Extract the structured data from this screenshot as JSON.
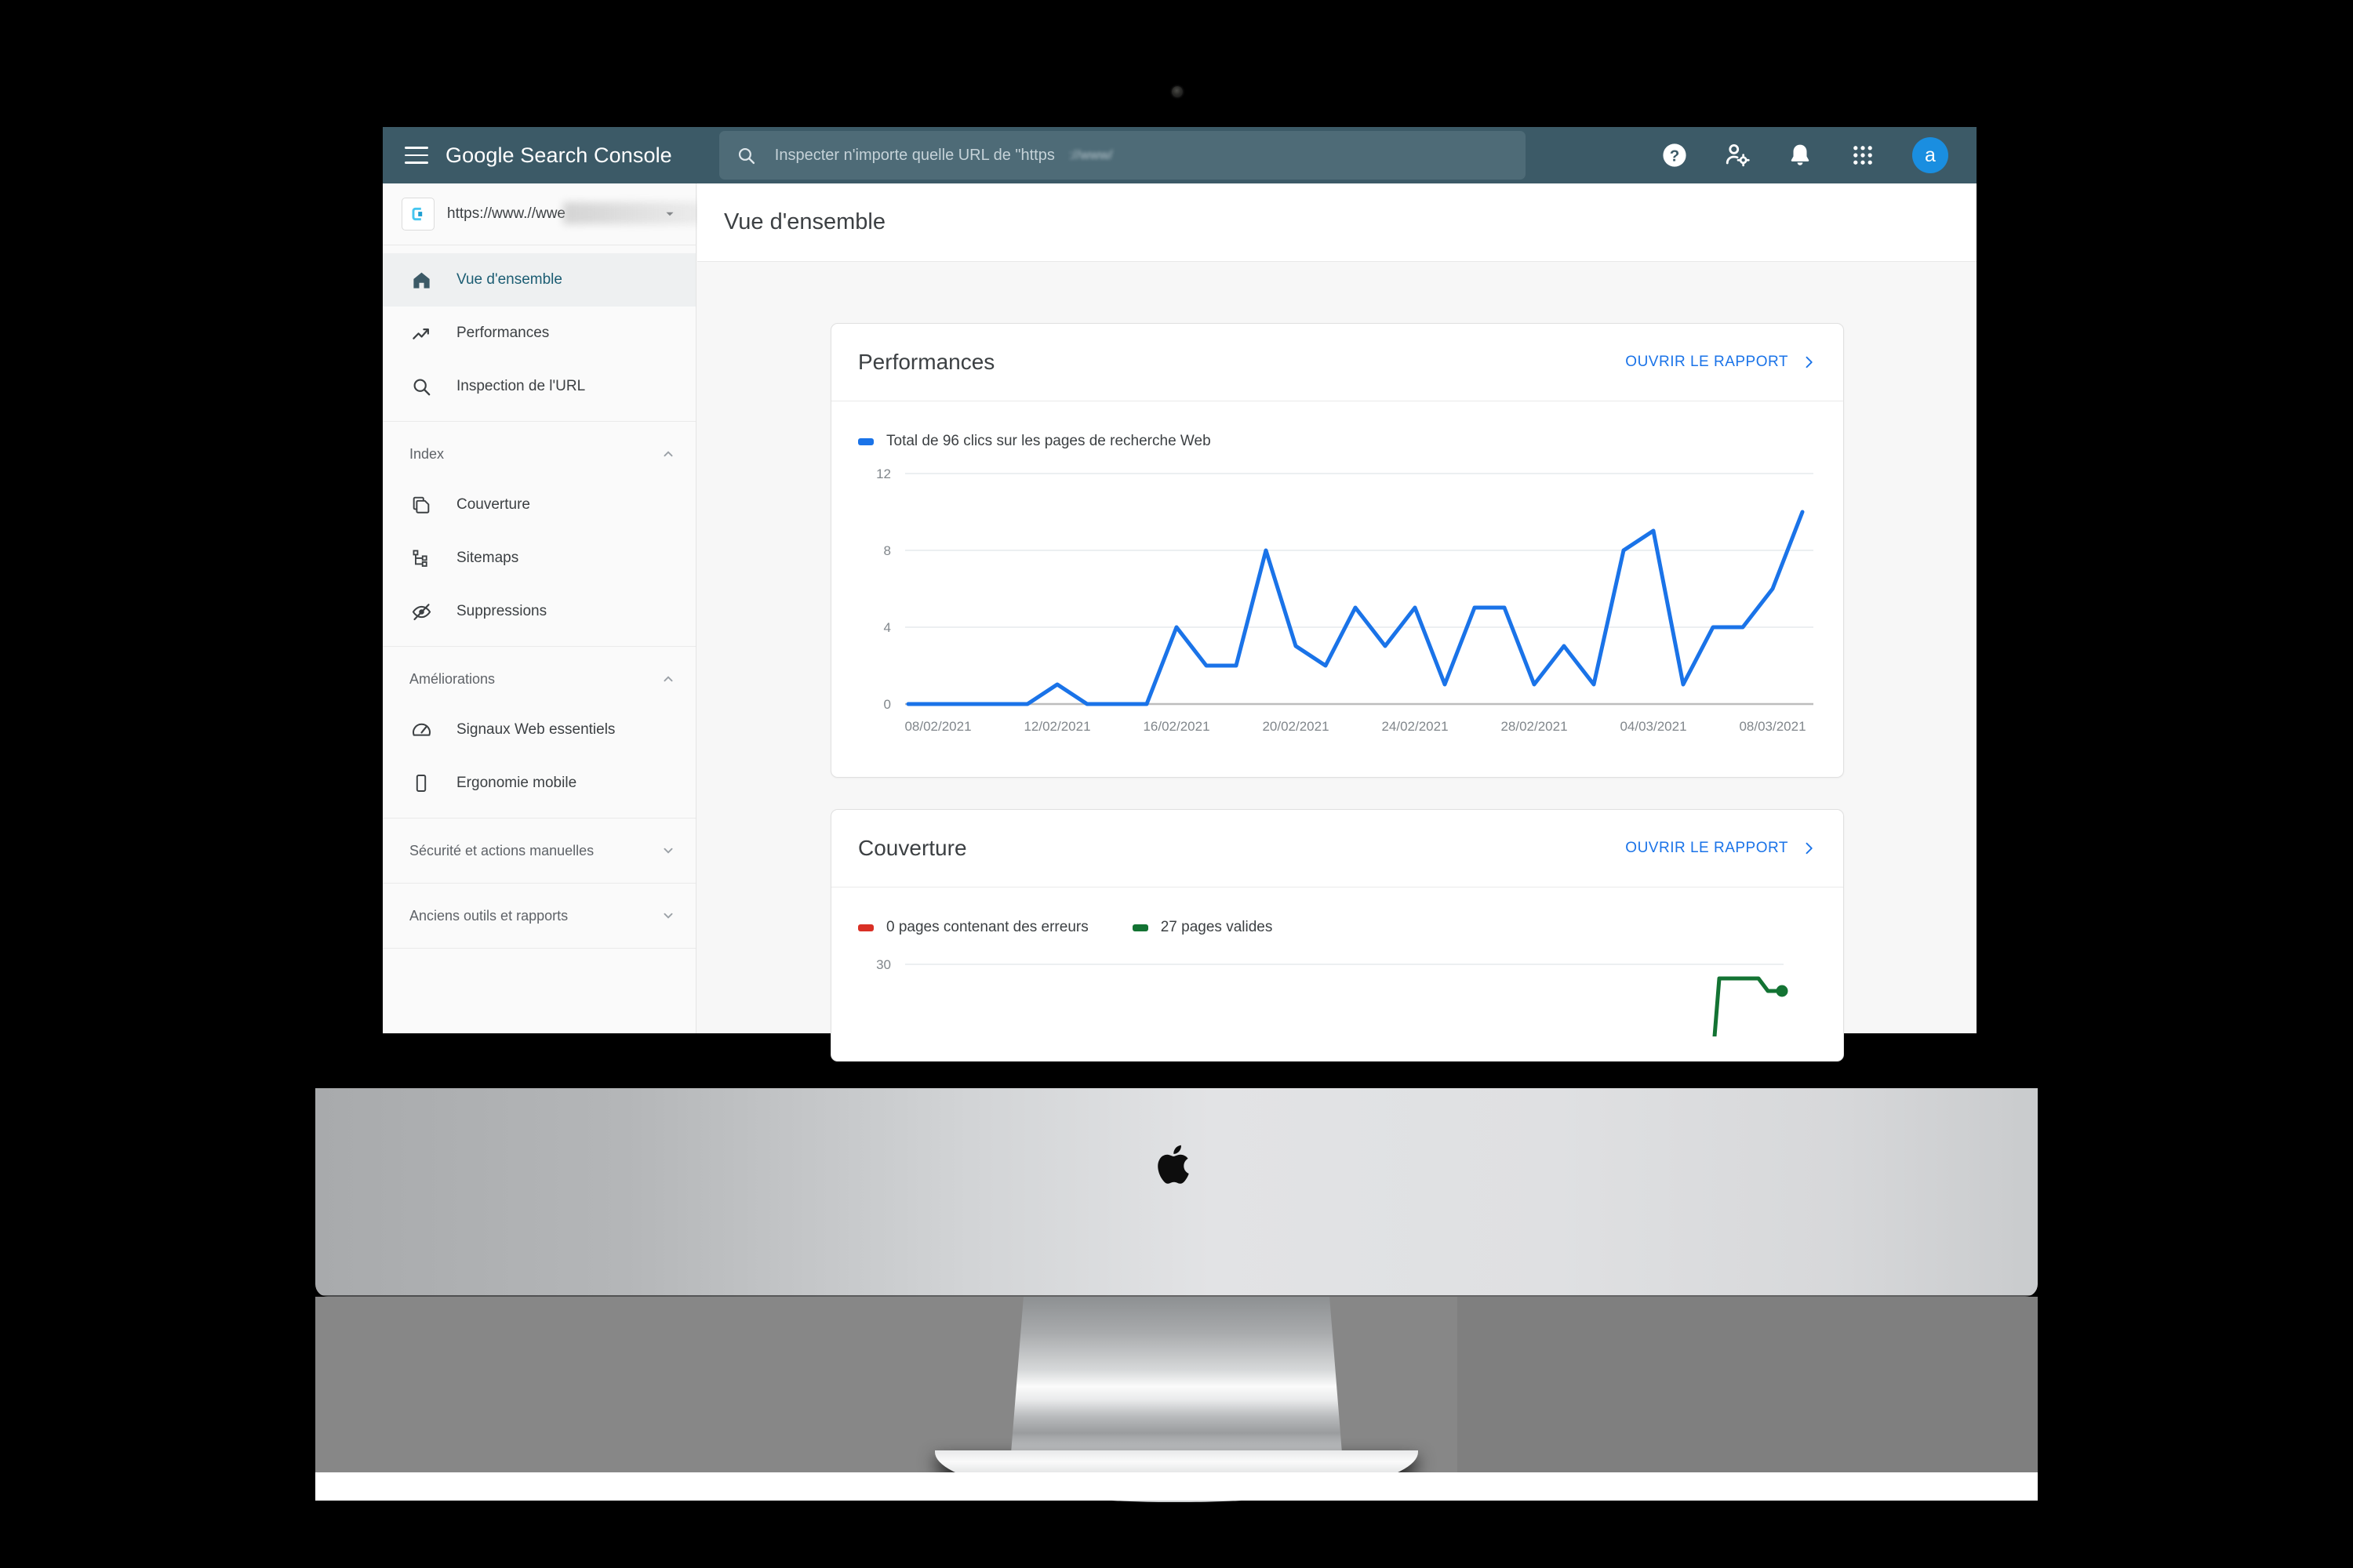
{
  "app": {
    "brand_strong": "Google",
    "brand_light": " Search Console",
    "menu_icon": "hamburger-menu-icon"
  },
  "search": {
    "placeholder": "Inspecter n'importe quelle URL de \"https",
    "blurred_suffix": "://www/",
    "icon": "search-icon"
  },
  "top_actions": {
    "help": "help-icon",
    "account_settings": "person-gear-icon",
    "notifications": "bell-icon",
    "apps_grid": "apps-grid-icon",
    "avatar_initial": "a"
  },
  "property": {
    "url": "https://www.//wwe",
    "icon": "property-logo-icon",
    "caret": "chevron-down-icon"
  },
  "sidebar": {
    "main_items": [
      {
        "label": "Vue d'ensemble",
        "icon": "home-icon",
        "active": true
      },
      {
        "label": "Performances",
        "icon": "trending-up-icon",
        "active": false
      },
      {
        "label": "Inspection de l'URL",
        "icon": "search-icon",
        "active": false
      }
    ],
    "groups": [
      {
        "title": "Index",
        "expanded": true,
        "items": [
          {
            "label": "Couverture",
            "icon": "pages-copy-icon"
          },
          {
            "label": "Sitemaps",
            "icon": "sitemap-icon"
          },
          {
            "label": "Suppressions",
            "icon": "eye-off-icon"
          }
        ]
      },
      {
        "title": "Améliorations",
        "expanded": true,
        "items": [
          {
            "label": "Signaux Web essentiels",
            "icon": "speedometer-icon"
          },
          {
            "label": "Ergonomie mobile",
            "icon": "mobile-icon"
          }
        ]
      },
      {
        "title": "Sécurité et actions manuelles",
        "expanded": false,
        "items": []
      },
      {
        "title": "Anciens outils et rapports",
        "expanded": false,
        "items": []
      }
    ]
  },
  "page": {
    "title": "Vue d'ensemble"
  },
  "cards": {
    "performance": {
      "title": "Performances",
      "open_report": "OUVRIR LE RAPPORT",
      "legend_label": "Total de 96 clics sur les pages de recherche Web",
      "legend_color": "#1a73e8"
    },
    "coverage": {
      "title": "Couverture",
      "open_report": "OUVRIR LE RAPPORT",
      "legend_errors": "0 pages contenant des erreurs",
      "legend_valid": "27 pages valides",
      "error_color": "#d93025",
      "valid_color": "#137333"
    }
  },
  "chart_data": [
    {
      "type": "line",
      "title": "Total de 96 clics sur les pages de recherche Web",
      "xlabel": "",
      "ylabel": "",
      "ylim": [
        0,
        12
      ],
      "yticks": [
        0,
        4,
        8,
        12
      ],
      "grid": true,
      "legend_position": "top-left",
      "series_color": "#1a73e8",
      "xtick_labels": [
        "08/02/2021",
        "12/02/2021",
        "16/02/2021",
        "20/02/2021",
        "24/02/2021",
        "28/02/2021",
        "04/03/2021",
        "08/03/2021"
      ],
      "x": [
        "07/02/2021",
        "08/02/2021",
        "09/02/2021",
        "10/02/2021",
        "11/02/2021",
        "12/02/2021",
        "13/02/2021",
        "14/02/2021",
        "15/02/2021",
        "16/02/2021",
        "17/02/2021",
        "18/02/2021",
        "19/02/2021",
        "20/02/2021",
        "21/02/2021",
        "22/02/2021",
        "23/02/2021",
        "24/02/2021",
        "25/02/2021",
        "26/02/2021",
        "27/02/2021",
        "28/02/2021",
        "01/03/2021",
        "02/03/2021",
        "03/03/2021",
        "04/03/2021",
        "05/03/2021",
        "06/03/2021",
        "07/03/2021",
        "08/03/2021",
        "09/03/2021"
      ],
      "values": [
        0,
        0,
        0,
        0,
        0,
        1,
        0,
        0,
        0,
        4,
        2,
        2,
        8,
        3,
        2,
        5,
        3,
        5,
        1,
        5,
        5,
        1,
        3,
        1,
        8,
        9,
        1,
        4,
        4,
        6,
        10
      ]
    },
    {
      "type": "line",
      "title": "Couverture",
      "ylim": [
        0,
        30
      ],
      "yticks": [
        30
      ],
      "grid": true,
      "legend_position": "top-left",
      "series": [
        {
          "name": "0 pages contenant des erreurs",
          "color": "#d93025",
          "values": [
            0,
            0,
            0,
            0,
            0,
            0,
            0,
            0,
            0,
            0,
            0
          ]
        },
        {
          "name": "27 pages valides",
          "color": "#137333",
          "values": [
            0,
            0,
            0,
            0,
            0,
            0,
            0,
            0,
            29,
            29,
            27
          ]
        }
      ]
    }
  ]
}
